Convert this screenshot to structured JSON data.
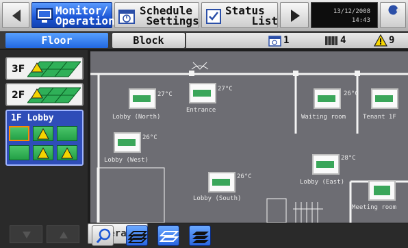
{
  "toolbar": {
    "monitor_label": "Monitor/\nOperation",
    "schedule_label": "Schedule\n Settings",
    "status_label": "Status\n    List",
    "date": "13/12/2008",
    "time": "14:43"
  },
  "tabs": {
    "floor": "Floor",
    "block": "Block"
  },
  "status_counts": {
    "schedule": "1",
    "filter": "4",
    "warning": "9"
  },
  "floors": [
    {
      "label": "3F"
    },
    {
      "label": "2F"
    },
    {
      "label": "1F Lobby"
    }
  ],
  "units": [
    {
      "name": "Lobby (North)",
      "temp": "27°C"
    },
    {
      "name": "Entrance",
      "temp": "27°C"
    },
    {
      "name": "Waiting room",
      "temp": "26°C"
    },
    {
      "name": "Tenant 1F",
      "temp": ""
    },
    {
      "name": "Lobby (West)",
      "temp": "26°C"
    },
    {
      "name": "Lobby (East)",
      "temp": "28°C"
    },
    {
      "name": "Lobby (South)",
      "temp": "26°C"
    },
    {
      "name": "Meeting room",
      "temp": ""
    }
  ],
  "actions": {
    "operate": "Operate"
  },
  "colors": {
    "active_blue": "#1c56d6",
    "zone_green": "#23a046",
    "warning_yellow": "#f5d400",
    "map_bg": "#6d6d73"
  }
}
